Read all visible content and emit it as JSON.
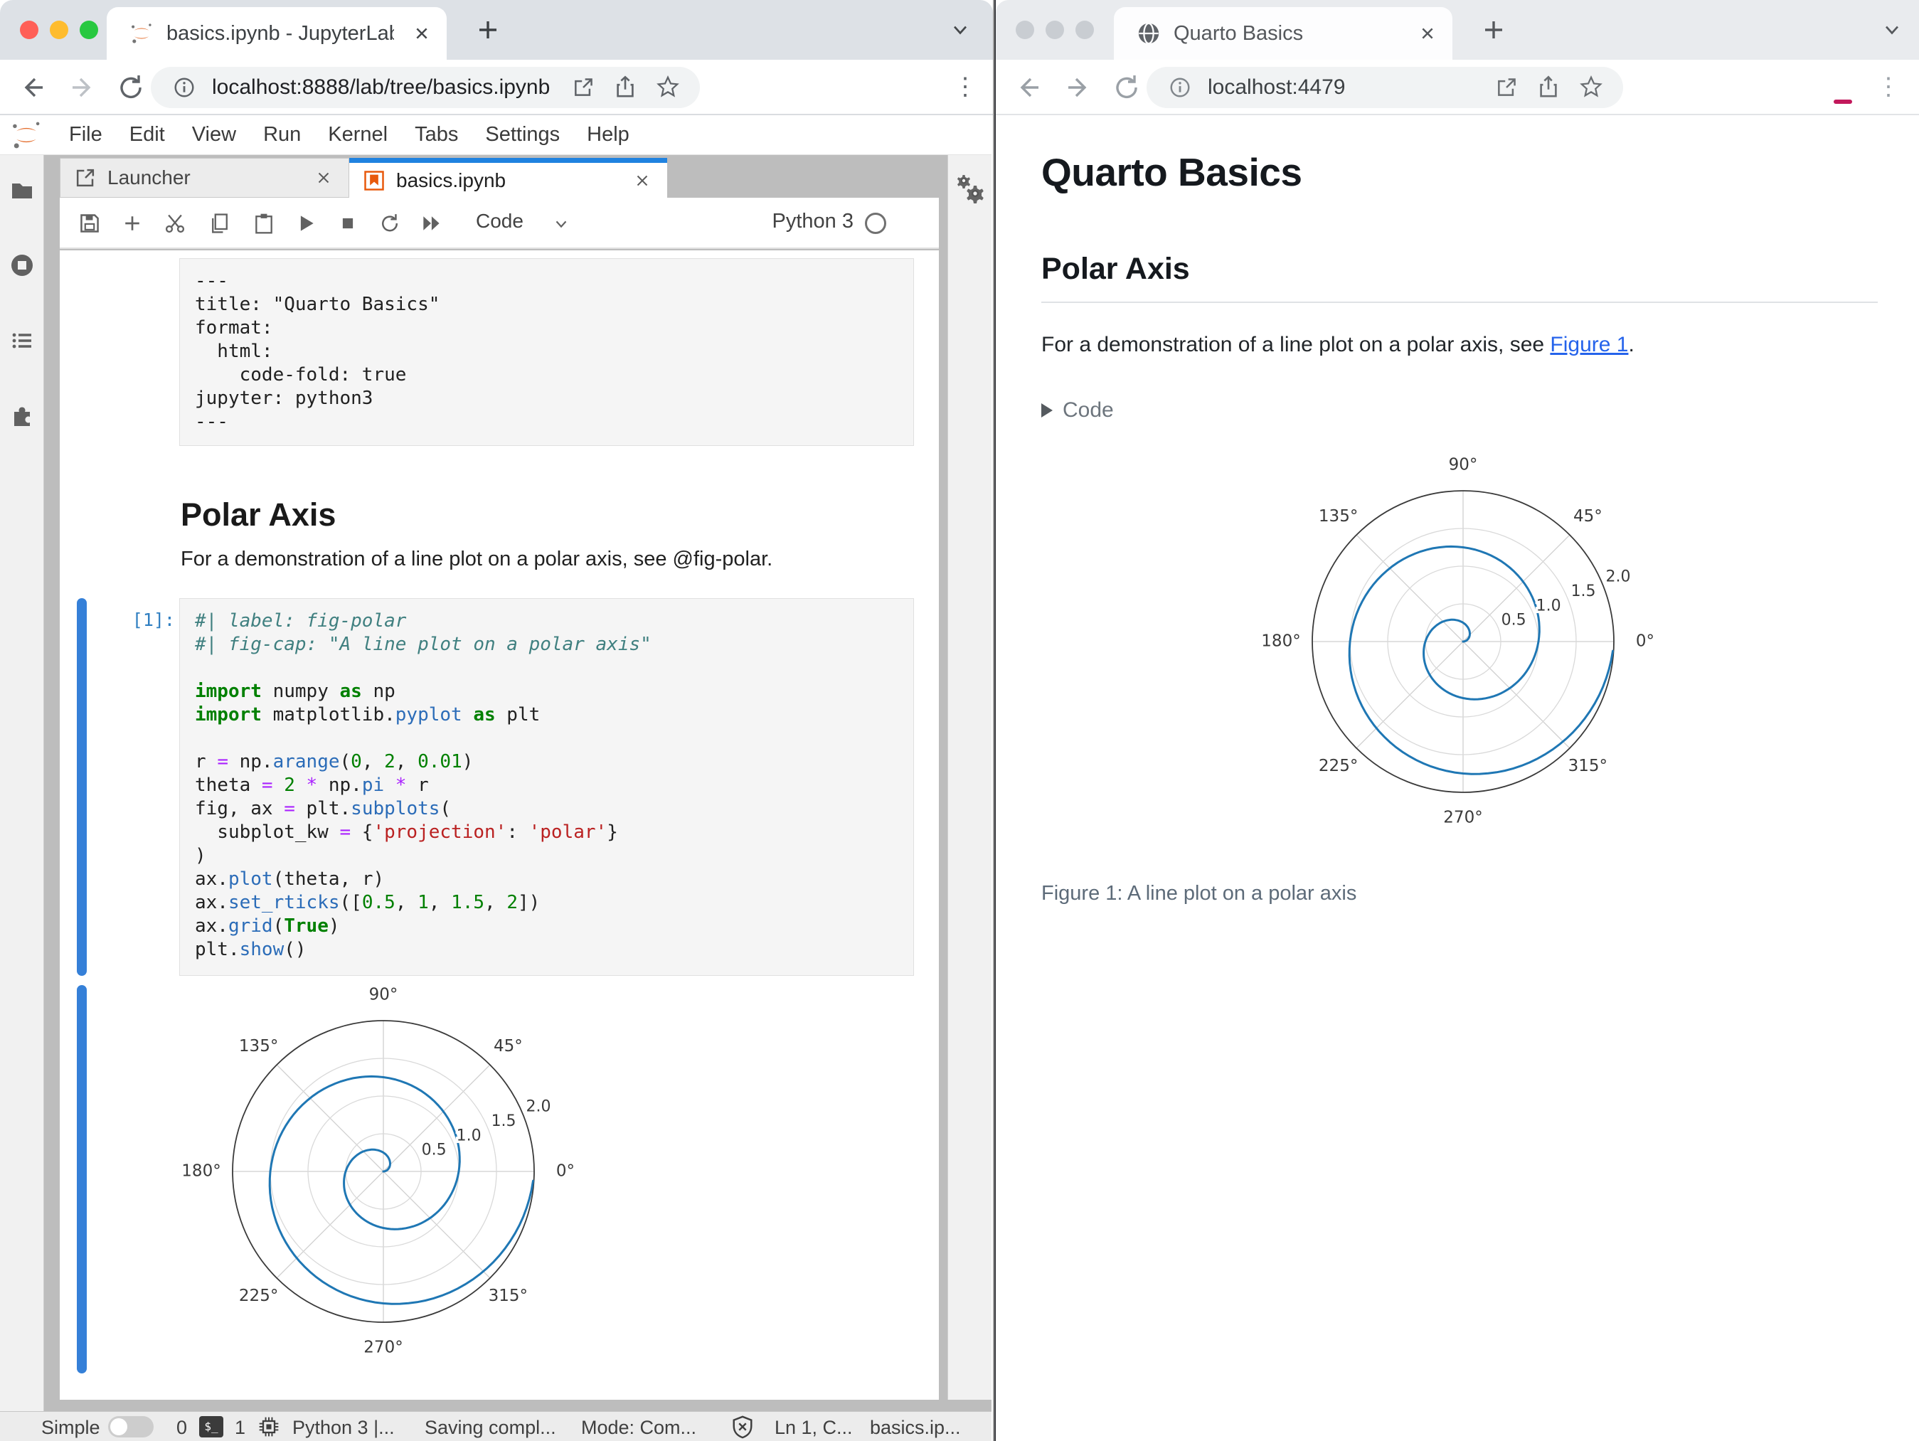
{
  "colors": {
    "accent_tab_blue": "#2082e0",
    "collapser_blue": "#3580d8",
    "prompt_blue": "#307fc1",
    "link_blue": "#2563eb",
    "spiral_blue": "#1f77b4",
    "jupyter_orange": "#e46e2e"
  },
  "left_window": {
    "browser": {
      "tab_title": "basics.ipynb - JupyterLab",
      "url": "localhost:8888/lab/tree/basics.ipynb"
    },
    "menu": [
      "File",
      "Edit",
      "View",
      "Run",
      "Kernel",
      "Tabs",
      "Settings",
      "Help"
    ],
    "dock_tabs": {
      "launcher": "Launcher",
      "notebook": "basics.ipynb"
    },
    "toolbar": {
      "cell_type": "Code",
      "kernel_name": "Python 3"
    },
    "notebook": {
      "raw_cell": "---\ntitle: \"Quarto Basics\"\nformat:\n  html:\n    code-fold: true\njupyter: python3\n---",
      "heading": "Polar Axis",
      "paragraph": "For a demonstration of a line plot on a polar axis, see @fig-polar.",
      "prompt": "[1]:",
      "code": [
        [
          [
            "c",
            "#| label: fig-polar"
          ]
        ],
        [
          [
            "c",
            "#| fig-cap: \"A line plot on a polar axis\""
          ]
        ],
        [],
        [
          [
            "k",
            "import"
          ],
          [
            "t",
            " numpy "
          ],
          [
            "k",
            "as"
          ],
          [
            "t",
            " np"
          ]
        ],
        [
          [
            "k",
            "import"
          ],
          [
            "t",
            " matplotlib."
          ],
          [
            "f",
            "pyplot"
          ],
          [
            "t",
            " "
          ],
          [
            "k",
            "as"
          ],
          [
            "t",
            " plt"
          ]
        ],
        [],
        [
          [
            "t",
            "r "
          ],
          [
            "o",
            "="
          ],
          [
            "t",
            " np."
          ],
          [
            "f",
            "arange"
          ],
          [
            "t",
            "("
          ],
          [
            "n",
            "0"
          ],
          [
            "t",
            ", "
          ],
          [
            "n",
            "2"
          ],
          [
            "t",
            ", "
          ],
          [
            "n",
            "0.01"
          ],
          [
            "t",
            ")"
          ]
        ],
        [
          [
            "t",
            "theta "
          ],
          [
            "o",
            "="
          ],
          [
            "t",
            " "
          ],
          [
            "n",
            "2"
          ],
          [
            "t",
            " "
          ],
          [
            "o",
            "*"
          ],
          [
            "t",
            " np."
          ],
          [
            "f",
            "pi"
          ],
          [
            "t",
            " "
          ],
          [
            "o",
            "*"
          ],
          [
            "t",
            " r"
          ]
        ],
        [
          [
            "t",
            "fig, ax "
          ],
          [
            "o",
            "="
          ],
          [
            "t",
            " plt."
          ],
          [
            "f",
            "subplots"
          ],
          [
            "t",
            "("
          ]
        ],
        [
          [
            "t",
            "  subplot_kw "
          ],
          [
            "o",
            "="
          ],
          [
            "t",
            " {"
          ],
          [
            "s",
            "'projection'"
          ],
          [
            "t",
            ": "
          ],
          [
            "s",
            "'polar'"
          ],
          [
            "t",
            "}"
          ]
        ],
        [
          [
            "t",
            ")"
          ]
        ],
        [
          [
            "t",
            "ax."
          ],
          [
            "f",
            "plot"
          ],
          [
            "t",
            "(theta, r)"
          ]
        ],
        [
          [
            "t",
            "ax."
          ],
          [
            "f",
            "set_rticks"
          ],
          [
            "t",
            "(["
          ],
          [
            "n",
            "0.5"
          ],
          [
            "t",
            ", "
          ],
          [
            "n",
            "1"
          ],
          [
            "t",
            ", "
          ],
          [
            "n",
            "1.5"
          ],
          [
            "t",
            ", "
          ],
          [
            "n",
            "2"
          ],
          [
            "t",
            "])"
          ]
        ],
        [
          [
            "t",
            "ax."
          ],
          [
            "f",
            "grid"
          ],
          [
            "t",
            "("
          ],
          [
            "k",
            "True"
          ],
          [
            "t",
            ")"
          ]
        ],
        [
          [
            "t",
            "plt."
          ],
          [
            "f",
            "show"
          ],
          [
            "t",
            "()"
          ]
        ]
      ]
    },
    "statusbar": {
      "mode_toggle": "Simple",
      "terminals": "0",
      "kernels": "1",
      "kernel_status": "Python 3 |...",
      "saving": "Saving compl...",
      "mode": "Mode: Com...",
      "line_col": "Ln 1, C...",
      "filename": "basics.ip..."
    }
  },
  "right_window": {
    "browser": {
      "tab_title": "Quarto Basics",
      "url": "localhost:4479"
    },
    "page": {
      "title": "Quarto Basics",
      "section": "Polar Axis",
      "para_before_link": "For a demonstration of a line plot on a polar axis, see ",
      "link_text": "Figure 1",
      "para_after_link": ".",
      "code_toggle_label": "Code",
      "figure_caption": "Figure 1: A line plot on a polar axis"
    }
  },
  "chart_data": {
    "type": "line",
    "projection": "polar",
    "title": "",
    "r_expression": "np.arange(0, 2, 0.01)",
    "theta_expression": "2 * np.pi * r",
    "r_range": [
      0,
      2
    ],
    "r_step": 0.01,
    "r_ticks": [
      0.5,
      1,
      1.5,
      2
    ],
    "r_tick_labels": [
      "0.5",
      "1.0",
      "1.5",
      "2.0"
    ],
    "rlabel_angle_deg": 22.5,
    "theta_ticks_deg": [
      0,
      45,
      90,
      135,
      180,
      225,
      270,
      315
    ],
    "theta_tick_labels": [
      "0°",
      "45°",
      "90°",
      "135°",
      "180°",
      "225°",
      "270°",
      "315°"
    ],
    "grid": true,
    "legend": false,
    "line_color": "#1f77b4",
    "instances": [
      "jupyter-notebook-output",
      "quarto-page-figure-1"
    ]
  }
}
